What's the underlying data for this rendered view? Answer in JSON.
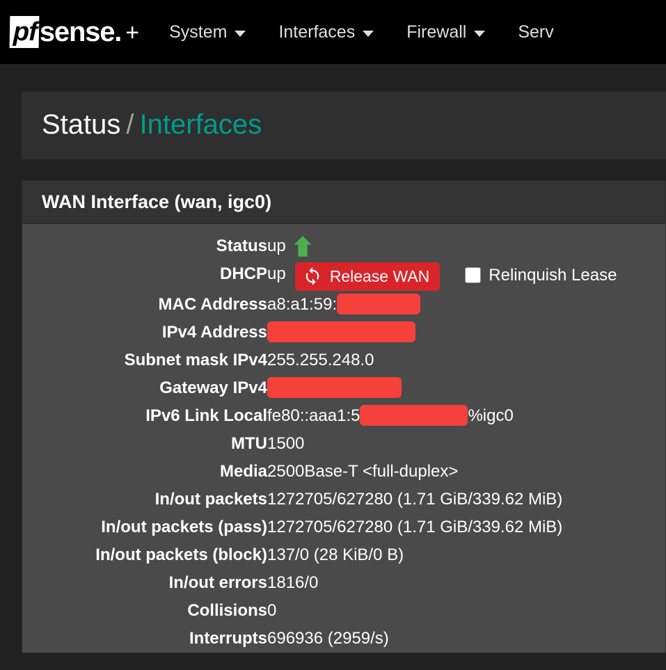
{
  "navbar": {
    "brand": {
      "pf": "pf",
      "sense": "sense.",
      "plus": "+"
    },
    "items": [
      {
        "label": "System",
        "has_caret": true
      },
      {
        "label": "Interfaces",
        "has_caret": true
      },
      {
        "label": "Firewall",
        "has_caret": true
      },
      {
        "label": "Serv",
        "has_caret": false
      }
    ]
  },
  "breadcrumb": {
    "root": "Status",
    "separator": "/",
    "current": "Interfaces"
  },
  "panel": {
    "title": "WAN Interface (wan, igc0)",
    "rows": [
      {
        "label": "Status",
        "value": "up",
        "icon": "arrow-up-icon"
      },
      {
        "label": "DHCP",
        "value": "up",
        "button": "Release WAN",
        "button_icon": "refresh-icon",
        "checkbox_label": "Relinquish Lease",
        "checkbox_checked": false
      },
      {
        "label": "MAC Address",
        "value": "a8:a1:59:",
        "redacted": "mac"
      },
      {
        "label": "IPv4 Address",
        "value": "",
        "redacted": "ipv4"
      },
      {
        "label": "Subnet mask IPv4",
        "value": "255.255.248.0"
      },
      {
        "label": "Gateway IPv4",
        "value": "",
        "redacted": "gw"
      },
      {
        "label": "IPv6 Link Local",
        "value": "fe80::aaa1:5",
        "redacted": "ipv6",
        "value_suffix": "%igc0"
      },
      {
        "label": "MTU",
        "value": "1500"
      },
      {
        "label": "Media",
        "value": "2500Base-T <full-duplex>"
      },
      {
        "label": "In/out packets",
        "value": "1272705/627280 (1.71 GiB/339.62 MiB)"
      },
      {
        "label": "In/out packets (pass)",
        "value": "1272705/627280 (1.71 GiB/339.62 MiB)"
      },
      {
        "label": "In/out packets (block)",
        "value": "137/0 (28 KiB/0 B)"
      },
      {
        "label": "In/out errors",
        "value": "1816/0"
      },
      {
        "label": "Collisions",
        "value": "0"
      },
      {
        "label": "Interrupts",
        "value": "696936 (2959/s)"
      }
    ]
  },
  "colors": {
    "navbar_bg": "#000000",
    "page_bg": "#212121",
    "panel_header_bg": "#333333",
    "panel_body_bg": "#4a4a4a",
    "breadcrumb_accent": "#009c8d",
    "status_up": "#4caf50",
    "button_red": "#d9242a",
    "redaction_red": "#f5403c"
  }
}
